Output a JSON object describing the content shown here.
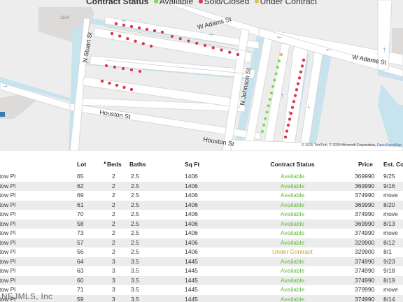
{
  "legend": {
    "title": "Contract Status",
    "items": [
      {
        "label": "Available",
        "color": "#7ed957"
      },
      {
        "label": "Sold/Closed",
        "color": "#d9364f"
      },
      {
        "label": "Under Contract",
        "color": "#d8c44a"
      }
    ]
  },
  "map": {
    "streets": [
      "W Adams St",
      "W Adams St",
      "N Stuart St",
      "N Johnson St",
      "Houston St",
      "Houston St"
    ],
    "building_number": "1104",
    "copyright_text": "© 2025 TomTom, © 2025 Microsoft Corporation, ",
    "copyright_link": "OpenStreetMap"
  },
  "table": {
    "columns": {
      "address": "",
      "lot": "Lot",
      "beds": "Beds",
      "baths": "Baths",
      "sqft": "Sq Ft",
      "status": "Contract Status",
      "price": "Price",
      "close": "Est. Co"
    },
    "sort_indicator": "▲",
    "rows": [
      {
        "address": "tow Pl",
        "lot": "65",
        "beds": "2",
        "baths": "2.5",
        "sqft": "1406",
        "status": "Available",
        "price": "369990",
        "close": "9/25"
      },
      {
        "address": "tow Pl",
        "lot": "62",
        "beds": "2",
        "baths": "2.5",
        "sqft": "1406",
        "status": "Available",
        "price": "369990",
        "close": "9/16"
      },
      {
        "address": "tow Pl",
        "lot": "69",
        "beds": "2",
        "baths": "2.5",
        "sqft": "1406",
        "status": "Available",
        "price": "374990",
        "close": "move"
      },
      {
        "address": "tow Pl",
        "lot": "61",
        "beds": "2",
        "baths": "2.5",
        "sqft": "1406",
        "status": "Available",
        "price": "369990",
        "close": "8/20"
      },
      {
        "address": "tow Pl",
        "lot": "70",
        "beds": "2",
        "baths": "2.5",
        "sqft": "1406",
        "status": "Available",
        "price": "374990",
        "close": "move"
      },
      {
        "address": "tow Pl",
        "lot": "58",
        "beds": "2",
        "baths": "2.5",
        "sqft": "1406",
        "status": "Available",
        "price": "369990",
        "close": "8/13"
      },
      {
        "address": "tow Pl",
        "lot": "73",
        "beds": "2",
        "baths": "2.5",
        "sqft": "1406",
        "status": "Available",
        "price": "374990",
        "close": "move"
      },
      {
        "address": "tow Pl",
        "lot": "57",
        "beds": "2",
        "baths": "2.5",
        "sqft": "1406",
        "status": "Available",
        "price": "329900",
        "close": "8/12"
      },
      {
        "address": "tow Pl",
        "lot": "56",
        "beds": "2",
        "baths": "2.5",
        "sqft": "1406",
        "status": "Under Contract",
        "price": "329900",
        "close": "8/1"
      },
      {
        "address": "tow Pl",
        "lot": "64",
        "beds": "3",
        "baths": "3.5",
        "sqft": "1445",
        "status": "Available",
        "price": "374990",
        "close": "9/23"
      },
      {
        "address": "tow Pl",
        "lot": "63",
        "beds": "3",
        "baths": "3.5",
        "sqft": "1445",
        "status": "Available",
        "price": "374990",
        "close": "9/18"
      },
      {
        "address": "tow Pl",
        "lot": "60",
        "beds": "3",
        "baths": "3.5",
        "sqft": "1445",
        "status": "Available",
        "price": "374990",
        "close": "8/19"
      },
      {
        "address": "tow Pl",
        "lot": "71",
        "beds": "3",
        "baths": "3.5",
        "sqft": "1445",
        "status": "Available",
        "price": "379990",
        "close": "move"
      },
      {
        "address": "tow Pl",
        "lot": "59",
        "beds": "3",
        "baths": "3.5",
        "sqft": "1445",
        "status": "Available",
        "price": "374990",
        "close": "8/14"
      }
    ]
  },
  "status_colors": {
    "Available": "#5fbf3a",
    "Under Contract": "#c9a227",
    "Sold/Closed": "#d9364f"
  },
  "watermark": "NEJMLS, Inc"
}
